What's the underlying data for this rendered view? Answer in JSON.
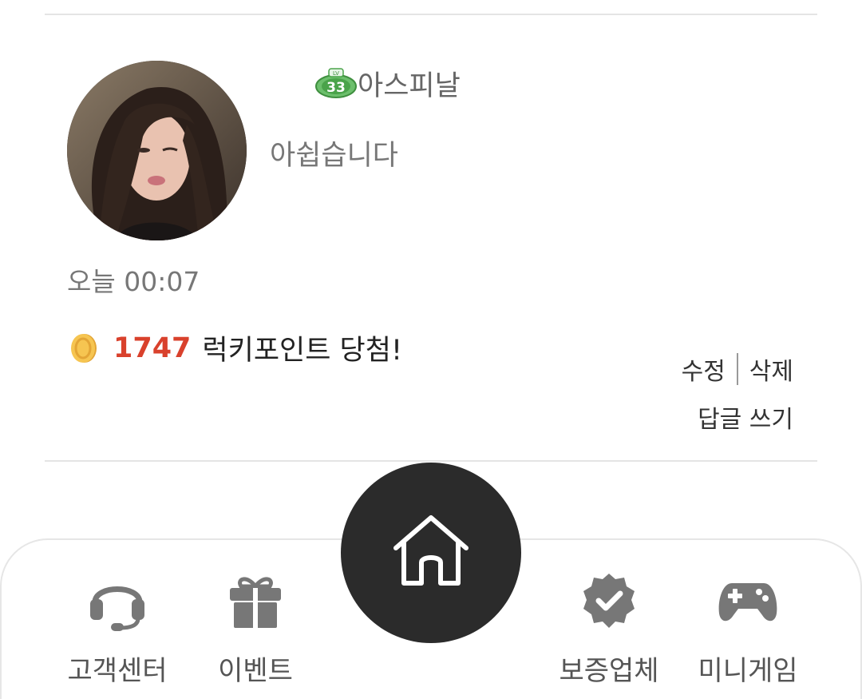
{
  "comment": {
    "username": "아스피날",
    "level": "33",
    "level_prefix": "LV",
    "text": "아쉽습니다",
    "timestamp": "오늘 00:07",
    "lucky": {
      "points": "1747",
      "text": "럭키포인트 당첨!"
    },
    "actions": {
      "edit_label": "수정",
      "delete_label": "삭제",
      "reply_label": "답글 쓰기"
    }
  },
  "bottom_nav": {
    "items": [
      {
        "label": "고객센터",
        "icon": "headset-icon"
      },
      {
        "label": "이벤트",
        "icon": "gift-icon"
      },
      {
        "label": "",
        "icon": "home-icon"
      },
      {
        "label": "보증업체",
        "icon": "verified-badge-icon"
      },
      {
        "label": "미니게임",
        "icon": "gamepad-icon"
      }
    ]
  },
  "colors": {
    "points": "#d9412c",
    "home_button": "#2b2b2b",
    "nav_icon": "#777777",
    "level_badge": "#5fb55f"
  }
}
